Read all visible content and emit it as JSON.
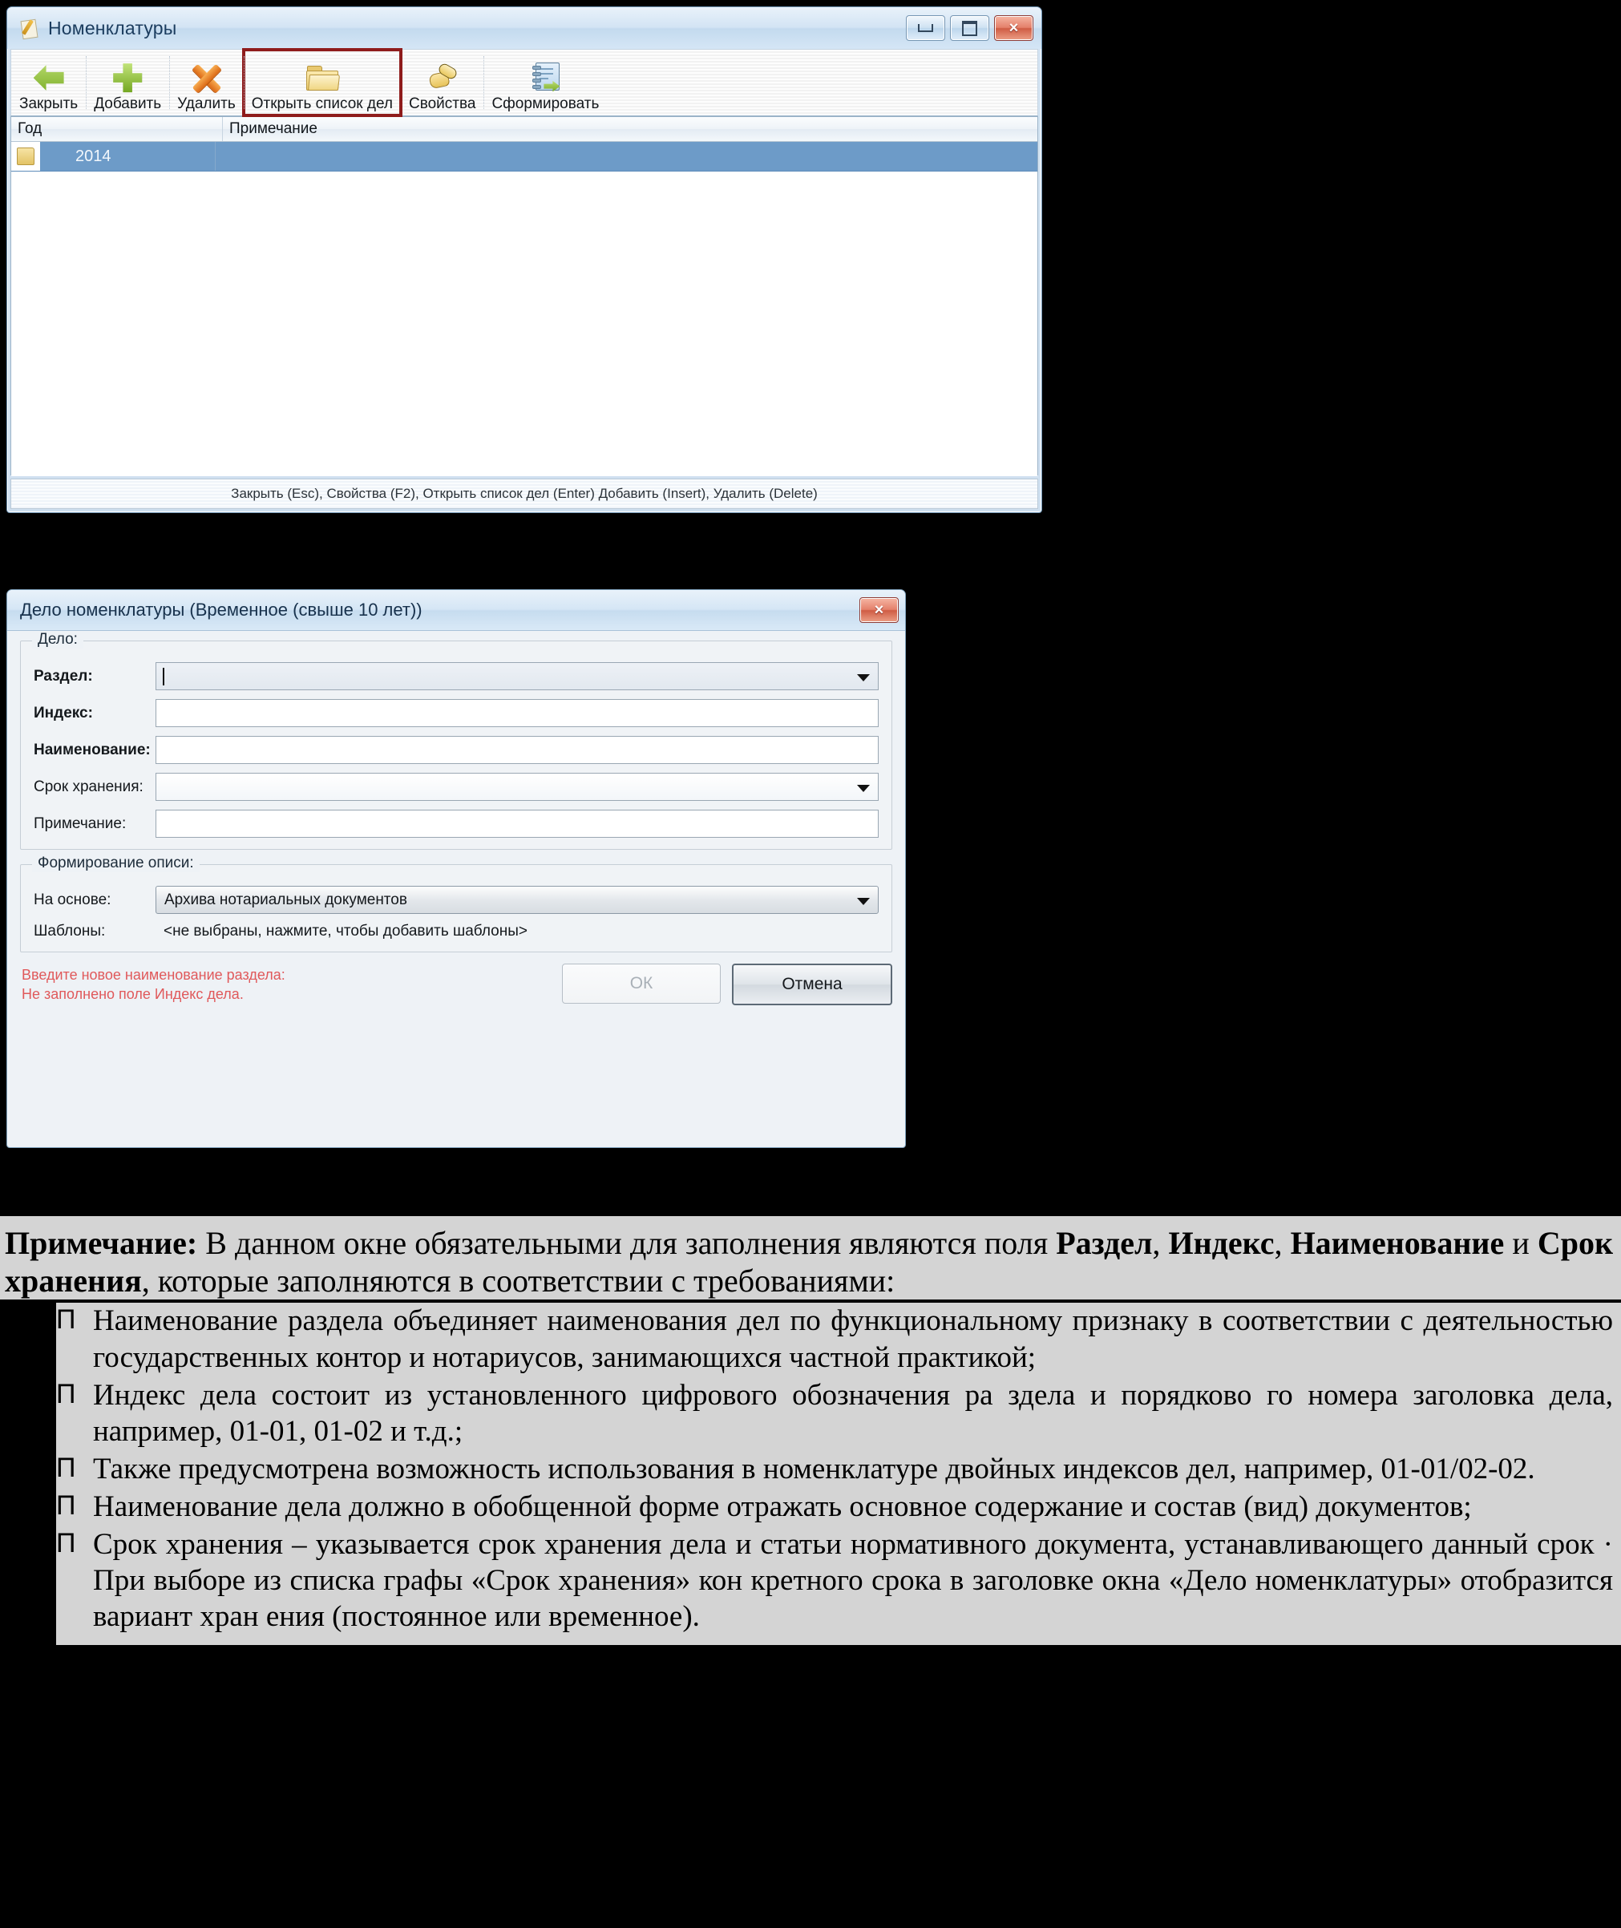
{
  "window1": {
    "title": "Номенклатуры",
    "icon": "notepad-pencil-icon",
    "controls": {
      "minimize": "minimize-icon",
      "maximize": "maximize-icon",
      "close": "×"
    },
    "toolbar": [
      {
        "label": "Закрыть",
        "icon": "green-back-arrow-icon"
      },
      {
        "label": "Добавить",
        "icon": "green-plus-icon"
      },
      {
        "label": "Удалить",
        "icon": "orange-cross-icon"
      },
      {
        "label": "Открыть список дел",
        "icon": "folder-icon",
        "highlighted": true
      },
      {
        "label": "Свойства",
        "icon": "pointing-hand-icon"
      },
      {
        "label": "Сформировать",
        "icon": "report-export-icon"
      }
    ],
    "grid": {
      "columns": [
        "Год",
        "Примечание"
      ],
      "rows": [
        {
          "year": "2014",
          "note": "",
          "selected": true
        }
      ]
    },
    "statusbar": "Закрыть (Esc), Свойства (F2), Открыть список дел (Enter) Добавить (Insert), Удалить (Delete)"
  },
  "window2": {
    "title": "Дело номенклатуры (Временное (свыше 10 лет))",
    "close_label": "×",
    "group_delo": {
      "caption": "Дело:",
      "fields": [
        {
          "label": "Раздел:",
          "value": "",
          "type": "combo",
          "required": true,
          "focused": true
        },
        {
          "label": "Индекс:",
          "value": "",
          "type": "text",
          "required": true
        },
        {
          "label": "Наименование:",
          "value": "",
          "type": "text",
          "required": true
        },
        {
          "label": "Срок хранения:",
          "value": "",
          "type": "combo",
          "required": false
        },
        {
          "label": "Примечание:",
          "value": "",
          "type": "text",
          "required": false
        }
      ]
    },
    "group_opis": {
      "caption": "Формирование описи:",
      "base_label": "На основе:",
      "base_value": "Архива нотариальных документов",
      "templates_label": "Шаблоны:",
      "templates_value": "<не выбраны, нажмите, чтобы добавить шаблоны>"
    },
    "errors": [
      "Введите новое наименование раздела:",
      "Не заполнено поле Индекс дела."
    ],
    "buttons": {
      "ok": "ОК",
      "cancel": "Отмена"
    },
    "error_color": "#e0595b"
  },
  "document": {
    "note_label": "Примечание:",
    "lead_line1_a": " В данном окне обязательными для заполнения являются поля ",
    "lead_b1": "Раздел",
    "lead_sep1": ", ",
    "lead_b2": "Индекс",
    "lead_sep2": ", ",
    "lead_b3": "Наименование",
    "lead_sep3": " и ",
    "lead_b4": "Срок хранения",
    "lead_tail": ", которые заполняются в соответствии с требованиями:",
    "bullet_glyph": "П",
    "bullets": [
      "Наименование раздела объединяет наименования дел по функциональному признаку в соответствии с деятельностью государственных контор и нотариусов, занимающихся частной практикой;",
      "Индекс дела состоит из установленного цифрового обозначения ра здела и порядково го номера заголовка дела, например, 01-01, 01-02 и т.д.;",
      "Также предусмотрена возможность использования в номенклатуре двойных индексов дел, например, 01-01/02-02.",
      "Наименование дела должно в обобщенной форме отражать основное содержание и состав (вид) документов;",
      "Срок хранения – указывается срок хранения дела и статьи   нормативного документа, устанавливающего данный срок · При выборе из списка графы «Срок хранения» кон кретного срока в заголовке окна «Дело номенклатуры» отобразится вариант хран ения (постоянное или временное)."
    ]
  }
}
